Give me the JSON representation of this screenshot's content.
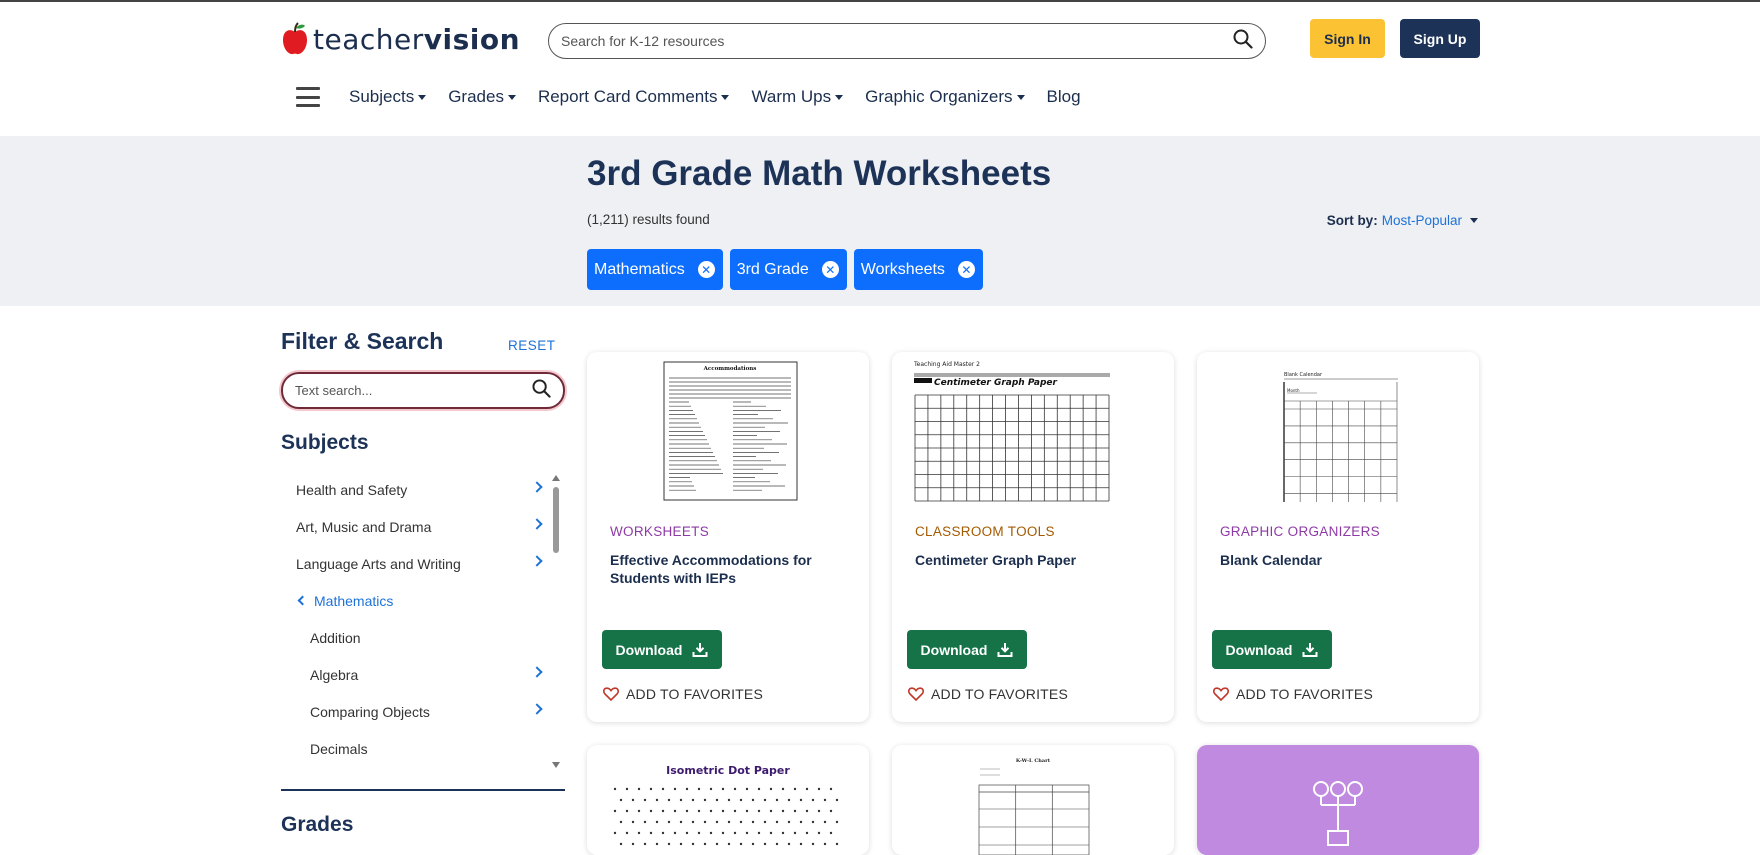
{
  "header": {
    "logo": {
      "part1": "teacher",
      "part2": "vision"
    },
    "search_placeholder": "Search for K-12 resources",
    "signin_label": "Sign In",
    "signup_label": "Sign Up",
    "nav": [
      {
        "label": "Subjects"
      },
      {
        "label": "Grades"
      },
      {
        "label": "Report Card Comments"
      },
      {
        "label": "Warm Ups"
      },
      {
        "label": "Graphic Organizers"
      },
      {
        "label": "Blog"
      }
    ]
  },
  "banner": {
    "title": "3rd Grade Math Worksheets",
    "results": "(1,211) results found",
    "sort_label": "Sort by:",
    "sort_value": "Most-Popular",
    "chips": [
      {
        "label": "Mathematics"
      },
      {
        "label": "3rd Grade"
      },
      {
        "label": "Worksheets"
      }
    ]
  },
  "sidebar": {
    "title": "Filter & Search",
    "reset": "RESET",
    "search_placeholder": "Text search...",
    "subjects_title": "Subjects",
    "subjects": [
      {
        "label": "Health and Safety"
      },
      {
        "label": "Art, Music and Drama"
      },
      {
        "label": "Language Arts and Writing"
      },
      {
        "label": "Mathematics"
      },
      {
        "label": "Addition"
      },
      {
        "label": "Algebra"
      },
      {
        "label": "Comparing Objects"
      },
      {
        "label": "Decimals"
      }
    ],
    "grades_title": "Grades"
  },
  "cards": [
    {
      "category": "WORKSHEETS",
      "title": "Effective Accommodations for Students with IEPs",
      "download": "Download",
      "favorite": "ADD TO FAVORITES",
      "thumb_title": "Accommodations",
      "color": "#8e3aa6"
    },
    {
      "category": "CLASSROOM TOOLS",
      "title": "Centimeter Graph Paper",
      "download": "Download",
      "favorite": "ADD TO FAVORITES",
      "thumb_title": "Centimeter Graph Paper",
      "thumb_sub": "Teaching Aid Master 2",
      "color": "#a45a00"
    },
    {
      "category": "GRAPHIC ORGANIZERS",
      "title": "Blank Calendar",
      "download": "Download",
      "favorite": "ADD TO FAVORITES",
      "thumb_title": "Blank Calendar",
      "thumb_sub": "Month",
      "color": "#8e3aa6"
    },
    {
      "thumb_title": "Isometric Dot Paper"
    },
    {
      "thumb_title": "K-W-L Chart"
    },
    {
      "thumb_color": "#c08ae0"
    }
  ]
}
